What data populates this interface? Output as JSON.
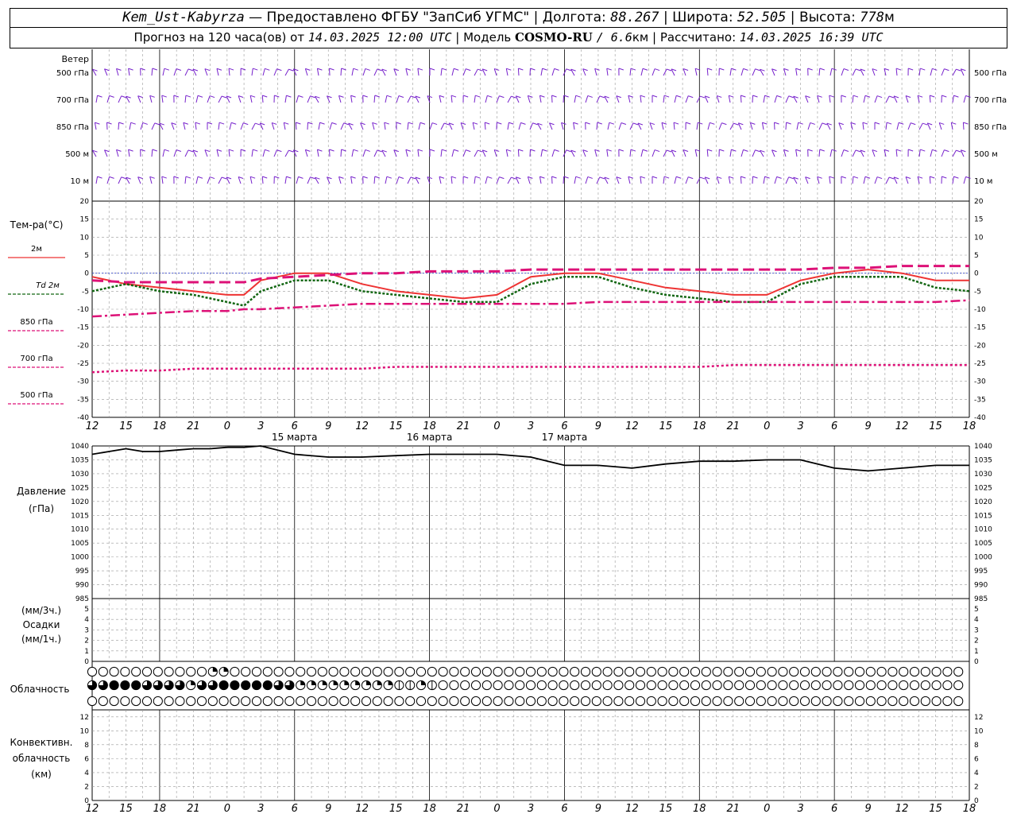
{
  "header": {
    "station": "Kem_Ust-Kabyrza",
    "provider": "— Предоставлено ФГБУ \"ЗапСиб УГМС\"",
    "lon_label": "Долгота:",
    "lon_value": "88.267",
    "lat_label": "Широта:",
    "lat_value": "52.505",
    "alt_label": "Высота:",
    "alt_value": "778",
    "alt_unit": "м",
    "forecast_prefix": "Прогноз на 120 часа(ов) от",
    "forecast_start": "14.03.2025 12:00 UTC",
    "model_label": "Модель",
    "model_name": "COSMO-RU",
    "model_res": "/ 6.6",
    "model_res_unit": "км",
    "computed_label": "Рассчитано:",
    "computed_value": "14.03.2025 16:39 UTC"
  },
  "time_axis": {
    "hour_labels": [
      "12",
      "15",
      "18",
      "21",
      "0",
      "3",
      "6",
      "9",
      "12",
      "15",
      "18",
      "21",
      "0",
      "3",
      "6",
      "9",
      "12",
      "15",
      "18",
      "21",
      "0",
      "3",
      "6",
      "9",
      "12",
      "15",
      "18"
    ],
    "day_labels": [
      "15 марта",
      "16 марта",
      "17 марта"
    ]
  },
  "labels": {
    "wind": "Ветер",
    "wind_levels": [
      "500 гПа",
      "700 гПа",
      "850 гПа",
      "500 м",
      "10  м"
    ],
    "temp_title": "Тем-ра(°С)",
    "temp_legend": [
      "2м",
      "Td  2м",
      "850 гПа",
      "700 гПа",
      "500 гПа"
    ],
    "pressure_title": "Давление",
    "pressure_unit": "(гПа)",
    "precip_unit_top": "(мм/3ч.)",
    "precip_title": "Осадки",
    "precip_unit_bottom": "(мм/1ч.)",
    "cloud_title": "Облачность",
    "conv_title1": "Конвективн.",
    "conv_title2": "облачность",
    "conv_unit": "(км)"
  },
  "colors": {
    "t2m": "#ee3333",
    "td2m": "#116611",
    "t850": "#dd1177",
    "t700": "#dd1177",
    "t500": "#dd1177",
    "wind": "#7722cc",
    "grid": "#999999"
  },
  "chart_data": [
    {
      "type": "line",
      "title": "Тем-ра(°С)",
      "ylim": [
        -40,
        20
      ],
      "yticks": [
        20,
        15,
        10,
        5,
        0,
        -5,
        -10,
        -15,
        -20,
        -25,
        -30,
        -35,
        -40
      ],
      "x_hours_from_start": [
        0,
        6,
        12,
        18,
        24,
        27,
        30,
        36,
        42,
        48,
        54,
        60,
        66,
        72,
        78,
        84,
        90,
        96,
        102,
        108,
        114,
        120,
        126,
        132,
        138,
        144,
        150,
        156
      ],
      "series": [
        {
          "name": "2м",
          "values": [
            -1,
            -3,
            -4,
            -5,
            -6,
            -6,
            -2,
            0,
            0,
            -3,
            -5,
            -6,
            -7,
            -6,
            -1,
            0,
            0,
            -2,
            -4,
            -5,
            -6,
            -6,
            -2,
            0,
            1,
            0,
            -2,
            -2
          ]
        },
        {
          "name": "Td  2м",
          "values": [
            -5,
            -3,
            -5,
            -6,
            -8,
            -9,
            -5,
            -2,
            -2,
            -5,
            -6,
            -7,
            -8,
            -8,
            -3,
            -1,
            -1,
            -4,
            -6,
            -7,
            -8,
            -8,
            -3,
            -1,
            -1,
            -1,
            -4,
            -5
          ]
        },
        {
          "name": "850 гПа",
          "values": [
            -12,
            -11.5,
            -11,
            -10.5,
            -10.5,
            -10,
            -10,
            -9.5,
            -9,
            -8.5,
            -8.5,
            -8.5,
            -8.5,
            -8.5,
            -8.5,
            -8.5,
            -8,
            -8,
            -8,
            -8,
            -8,
            -8,
            -8,
            -8,
            -8,
            -8,
            -8,
            -7.5
          ]
        },
        {
          "name": "700 гПа",
          "values": [
            -2,
            -2.5,
            -2.5,
            -2.5,
            -2.5,
            -2.5,
            -1.5,
            -1,
            -0.5,
            0,
            0,
            0.5,
            0.5,
            0.5,
            1,
            1,
            1,
            1,
            1,
            1,
            1,
            1,
            1,
            1.5,
            1.5,
            2,
            2,
            2
          ]
        },
        {
          "name": "500 гПа",
          "values": [
            -27.5,
            -27,
            -27,
            -26.5,
            -26.5,
            -26.5,
            -26.5,
            -26.5,
            -26.5,
            -26.5,
            -26,
            -26,
            -26,
            -26,
            -26,
            -26,
            -26,
            -26,
            -26,
            -26,
            -25.5,
            -25.5,
            -25.5,
            -25.5,
            -25.5,
            -25.5,
            -25.5,
            -25.5
          ]
        }
      ]
    },
    {
      "type": "line",
      "title": "Давление",
      "ylabel": "(гПа)",
      "ylim": [
        985,
        1040
      ],
      "yticks": [
        1040,
        1035,
        1030,
        1025,
        1020,
        1015,
        1010,
        1005,
        1000,
        995,
        990,
        985
      ],
      "x_hours_from_start": [
        0,
        3,
        6,
        9,
        12,
        15,
        18,
        21,
        24,
        27,
        30,
        36,
        42,
        48,
        54,
        60,
        66,
        72,
        78,
        84,
        90,
        96,
        102,
        108,
        114,
        120,
        126,
        132,
        138,
        144,
        150,
        156
      ],
      "series": [
        {
          "name": "",
          "values": [
            1037,
            1038,
            1039,
            1038,
            1038,
            1038.5,
            1039,
            1039,
            1039.5,
            1039.5,
            1040,
            1037,
            1036,
            1036,
            1036.5,
            1037,
            1037,
            1037,
            1036,
            1033,
            1033,
            1032,
            1033.5,
            1034.5,
            1034.5,
            1035,
            1035,
            1032,
            1031,
            1032,
            1033,
            1033
          ]
        }
      ]
    },
    {
      "type": "bar",
      "title": "Осадки",
      "ylim": [
        0,
        5
      ],
      "yticks": [
        5,
        4,
        3,
        2,
        1,
        0
      ],
      "values": []
    },
    {
      "type": "bar",
      "title": "Конвективн. облачность",
      "ylabel": "(км)",
      "ylim": [
        0,
        13
      ],
      "yticks": [
        12,
        10,
        8,
        6,
        4,
        2,
        0
      ],
      "values": []
    }
  ],
  "cloud_rows": {
    "upper": [
      0,
      0,
      0,
      0,
      0,
      0,
      0,
      0,
      0,
      0,
      0,
      2,
      2,
      0,
      0,
      0,
      0,
      0,
      0,
      0,
      0,
      0,
      0,
      0,
      0,
      0,
      0,
      0,
      0,
      0,
      0,
      0,
      0,
      0,
      0,
      0,
      0,
      0,
      0,
      0,
      0,
      0,
      0,
      0,
      0,
      0,
      0,
      0,
      0,
      0,
      0,
      0,
      0,
      0,
      0,
      0,
      0,
      0,
      0,
      0,
      0,
      0,
      0,
      0,
      0,
      0,
      0,
      0,
      0,
      0,
      0,
      0,
      0,
      0,
      0,
      0,
      0,
      0,
      0,
      0
    ],
    "middle": [
      3,
      3,
      4,
      4,
      4,
      3,
      3,
      3,
      3,
      2,
      3,
      3,
      4,
      4,
      4,
      4,
      4,
      3,
      3,
      2,
      2,
      2,
      2,
      2,
      2,
      2,
      2,
      2,
      1,
      1,
      2,
      1,
      0,
      0,
      0,
      0,
      0,
      0,
      0,
      0,
      0,
      0,
      0,
      0,
      0,
      0,
      0,
      0,
      0,
      0,
      0,
      0,
      0,
      0,
      0,
      0,
      0,
      0,
      0,
      0,
      0,
      0,
      0,
      0,
      0,
      0,
      0,
      0,
      0,
      0,
      0,
      0,
      0,
      0,
      0,
      0,
      0,
      0,
      0,
      0
    ],
    "lower": [
      0,
      0,
      0,
      0,
      0,
      0,
      0,
      0,
      0,
      0,
      0,
      0,
      0,
      0,
      0,
      0,
      0,
      0,
      0,
      0,
      0,
      0,
      0,
      0,
      0,
      0,
      0,
      0,
      0,
      0,
      0,
      0,
      0,
      0,
      0,
      0,
      0,
      0,
      0,
      0,
      0,
      0,
      0,
      0,
      0,
      0,
      0,
      0,
      0,
      0,
      0,
      0,
      0,
      0,
      0,
      0,
      0,
      0,
      0,
      0,
      0,
      0,
      0,
      0,
      0,
      0,
      0,
      0,
      0,
      0,
      0,
      0,
      0,
      0,
      0,
      0,
      0,
      0,
      0,
      0
    ]
  }
}
